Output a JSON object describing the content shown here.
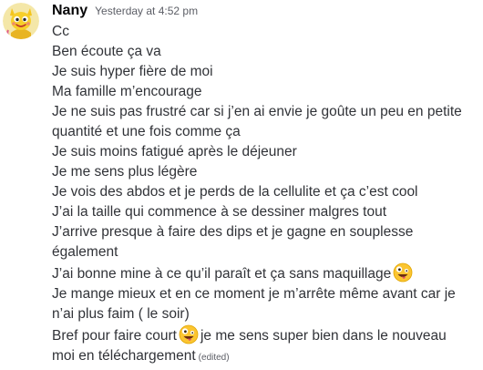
{
  "message": {
    "author": "Nany",
    "timestamp": "Yesterday at 4:52 pm",
    "edited_label": "(edited)",
    "avatar_icon": "yellow-cartoon-avatar",
    "emoji_name": "zany-face-emoji",
    "lines": {
      "l1": "Cc",
      "l2": "Ben écoute ça va",
      "l3": "Je suis hyper fière de moi",
      "l4": "Ma famille m’encourage",
      "l5": "Je ne suis pas frustré car si j’en ai envie je goûte un peu en petite",
      "l6": "quantité et une fois comme ça",
      "l7": "Je suis moins fatigué après le déjeuner",
      "l8": "Je me sens plus légère",
      "l9": "Je vois des abdos et je perds de la cellulite et ça c’est cool",
      "l10": "J’ai la taille qui commence à se dessiner malgres tout",
      "l11": "J’arrive presque à faire des dips et je gagne en souplesse",
      "l12": "également",
      "l13": "J’ai bonne mine à ce qu’il paraît et ça sans maquillage",
      "l14": "Je mange mieux et en ce moment je m’arrête même avant car je",
      "l15": "n’ai plus faim ( le soir)",
      "l16a": "Bref pour faire court",
      "l16b": "je me sens super bien dans le nouveau",
      "l17": "moi en téléchargement"
    }
  }
}
